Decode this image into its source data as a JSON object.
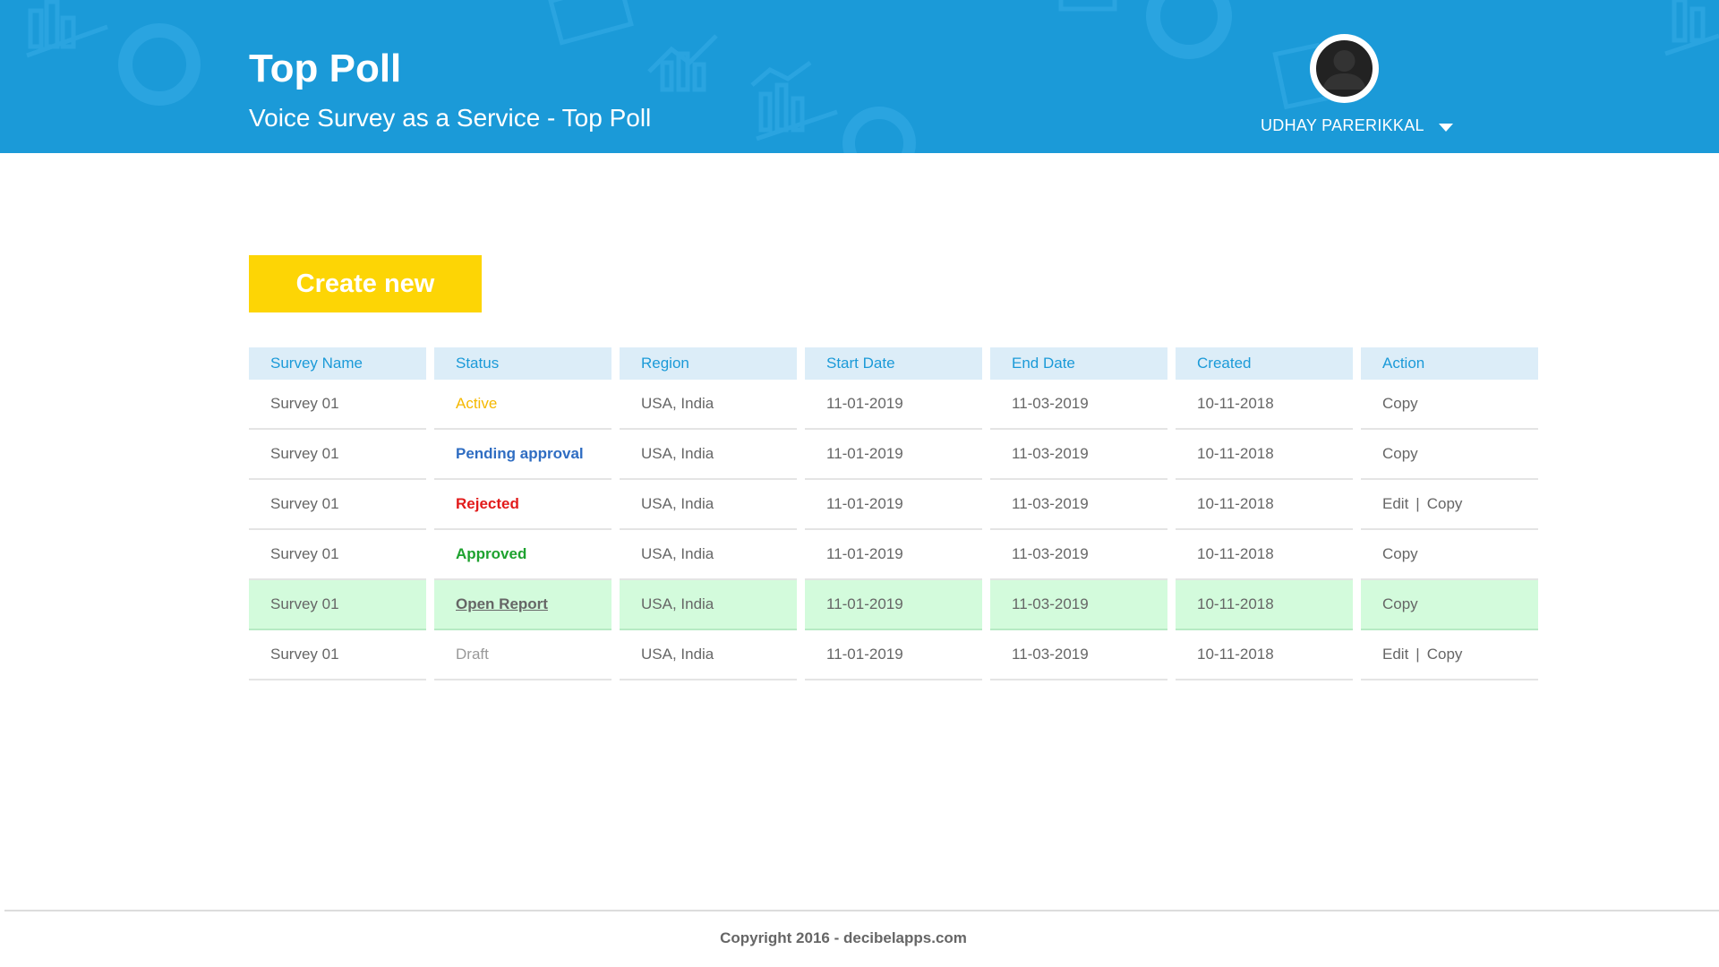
{
  "header": {
    "title": "Top Poll",
    "subtitle": "Voice Survey as a Service - Top Poll",
    "user_name": "UDHAY PARERIKKAL",
    "bg_color": "#1b9ad8"
  },
  "actions": {
    "create_label": "Create new",
    "create_color": "#fdd505"
  },
  "table": {
    "columns": [
      "Survey Name",
      "Status",
      "Region",
      "Start Date",
      "End Date",
      "Created",
      "Action"
    ],
    "rows": [
      {
        "name": "Survey 01",
        "status": "Active",
        "region": "USA, India",
        "start": "11-01-2019",
        "end": "11-03-2019",
        "created": "10-11-2018",
        "edit": "",
        "copy": "Copy"
      },
      {
        "name": "Survey 01",
        "status": "Pending approval",
        "region": "USA, India",
        "start": "11-01-2019",
        "end": "11-03-2019",
        "created": "10-11-2018",
        "edit": "",
        "copy": "Copy"
      },
      {
        "name": "Survey 01",
        "status": "Rejected",
        "region": "USA, India",
        "start": "11-01-2019",
        "end": "11-03-2019",
        "created": "10-11-2018",
        "edit": "Edit",
        "copy": "Copy"
      },
      {
        "name": "Survey 01",
        "status": "Approved",
        "region": "USA, India",
        "start": "11-01-2019",
        "end": "11-03-2019",
        "created": "10-11-2018",
        "edit": "",
        "copy": "Copy"
      },
      {
        "name": "Survey 01",
        "status": "Open Report",
        "region": "USA, India",
        "start": "11-01-2019",
        "end": "11-03-2019",
        "created": "10-11-2018",
        "edit": "",
        "copy": "Copy"
      },
      {
        "name": "Survey 01",
        "status": "Draft",
        "region": "USA, India",
        "start": "11-01-2019",
        "end": "11-03-2019",
        "created": "10-11-2018",
        "edit": "Edit",
        "copy": "Copy"
      }
    ],
    "action_separator": "|",
    "status_colors": {
      "Active": "#f5b800",
      "Pending approval": "#2f6dc2",
      "Rejected": "#e21b1b",
      "Approved": "#1ea22f",
      "Draft": "#999999"
    },
    "highlight_color": "#d3fbdc"
  },
  "footer": {
    "copyright": "Copyright 2016 - decibelapps.com"
  }
}
